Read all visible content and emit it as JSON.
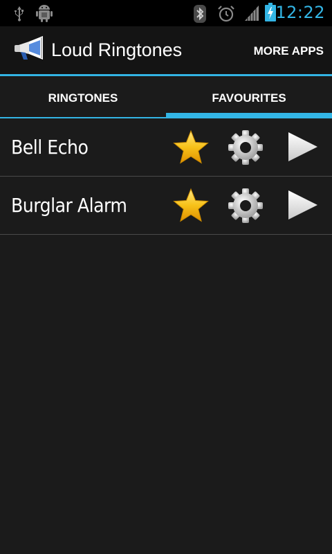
{
  "status_bar": {
    "time": "12:22",
    "icons": [
      "usb-icon",
      "android-debug-icon",
      "bluetooth-icon",
      "alarm-icon",
      "signal-icon",
      "battery-charging-icon"
    ],
    "accent": "#33b5e5"
  },
  "action_bar": {
    "title": "Loud Ringtones",
    "app_icon": "megaphone-icon",
    "more_apps_label": "MORE APPS"
  },
  "tabs": [
    {
      "label": "RINGTONES",
      "selected": false
    },
    {
      "label": "FAVOURITES",
      "selected": true
    }
  ],
  "ringtones": [
    {
      "name": "Bell Echo",
      "favourite": true
    },
    {
      "name": "Burglar Alarm",
      "favourite": true
    }
  ],
  "row_icons": [
    "star-icon",
    "gear-icon",
    "play-icon"
  ],
  "colors": {
    "accent": "#33b5e5",
    "background": "#1b1b1b",
    "star": "#f5b800",
    "divider": "#4a4a4a"
  }
}
